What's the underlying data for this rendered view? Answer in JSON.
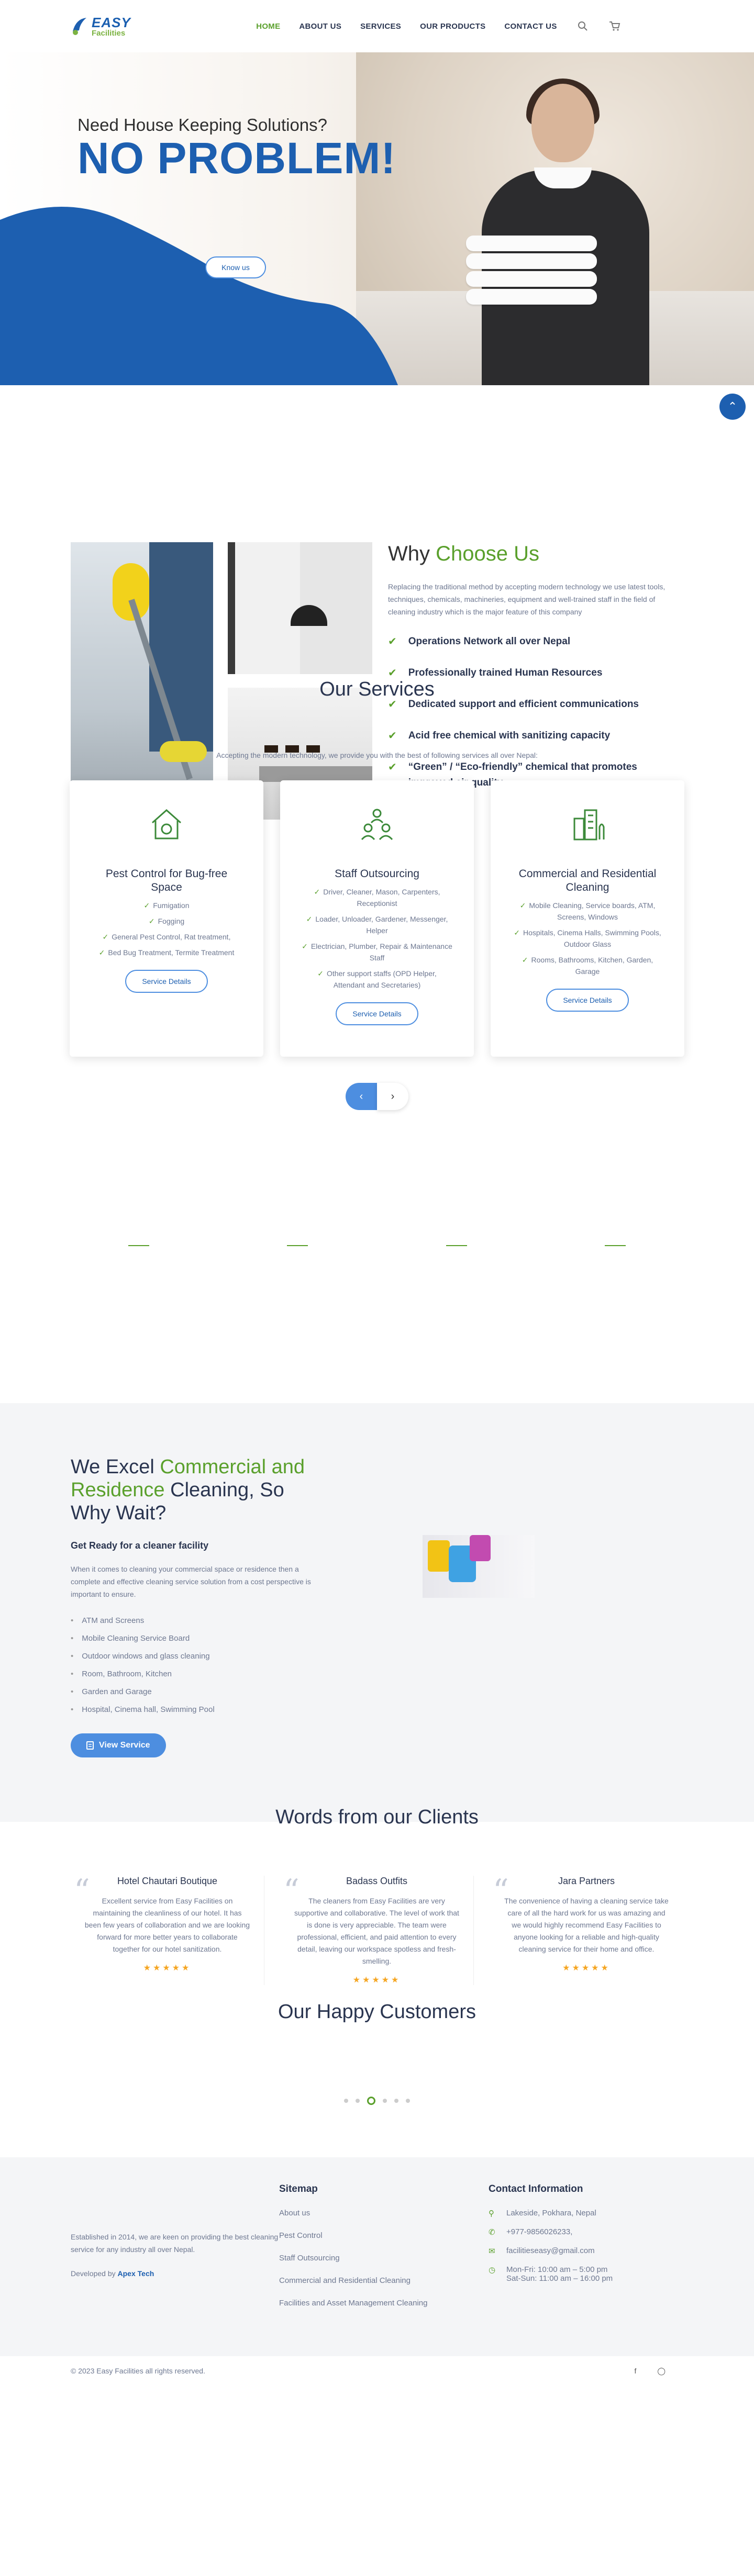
{
  "nav": {
    "logo_top": "EASY",
    "logo_bottom": "Facilities",
    "menu": [
      "HOME",
      "ABOUT US",
      "SERVICES",
      "OUR PRODUCTS",
      "CONTACT US"
    ],
    "search_icon": "search-icon",
    "cart_icon": "cart-icon"
  },
  "hero": {
    "subtitle": "Need House Keeping Solutions?",
    "title": "NO PROBLEM!",
    "button": "Know us",
    "scroll_icon": "chevron-up-icon",
    "wave_color": "#1d5fb0"
  },
  "why": {
    "title_a": "Why ",
    "title_b": "Choose Us",
    "lead": "Replacing the traditional method by accepting modern technology we use latest tools, techniques, chemicals, machineries, equipment and well-trained staff in the field of cleaning industry which is the major feature of this company",
    "items": [
      "Operations Network all over Nepal",
      "Professionally trained Human Resources",
      "Dedicated support and efficient communications",
      "Acid free chemical with sanitizing capacity",
      "“Green” / “Eco-friendly” chemical that promotes improved air quality"
    ]
  },
  "services": {
    "title": "Our Services",
    "lead": "Accepting the modern technology, we provide you with the best of following services all over Nepal:",
    "cards": [
      {
        "title": "Pest Control for Bug-free Space",
        "items": [
          "Fumigation",
          "Fogging",
          "General Pest Control, Rat treatment,",
          "Bed Bug Treatment, Termite Treatment"
        ],
        "button": "Service Details"
      },
      {
        "title": "Staff Outsourcing",
        "items": [
          "Driver, Cleaner, Mason, Carpenters, Receptionist",
          "Loader, Unloader, Gardener, Messenger, Helper",
          "Electrician, Plumber, Repair & Maintenance Staff",
          "Other support staffs (OPD Helper, Attendant and Secretaries)"
        ],
        "button": "Service Details"
      },
      {
        "title": "Commercial and Residential Cleaning",
        "items": [
          "Mobile Cleaning, Service boards, ATM, Screens, Windows",
          "Hospitals, Cinema Halls, Swimming Pools, Outdoor Glass",
          "Rooms, Bathrooms, Kitchen, Garden, Garage"
        ],
        "button": "Service Details"
      }
    ],
    "prev": "‹",
    "next": "›"
  },
  "excel": {
    "title_a": "We Excel ",
    "title_b": "Commercial and Residence",
    "title_c": " Cleaning, So Why Wait?",
    "subtitle": "Get Ready for a cleaner facility",
    "lead": "When it comes to cleaning your commercial space or residence then a complete and effective cleaning service solution from a cost perspective is important to ensure.",
    "items": [
      "ATM and Screens",
      "Mobile Cleaning Service Board",
      "Outdoor windows and glass cleaning",
      "Room, Bathroom, Kitchen",
      "Garden and Garage",
      "Hospital, Cinema hall, Swimming Pool"
    ],
    "button": "View Service"
  },
  "testimonials": {
    "title": "Words from our Clients",
    "items": [
      {
        "name": "Hotel Chautari Boutique",
        "text": "Excellent service from Easy Facilities on maintaining the cleanliness of our hotel. It has been few years of collaboration and we are looking forward for more better years to collaborate together for our hotel sanitization.",
        "stars": "★★★★★"
      },
      {
        "name": "Badass Outfits",
        "text": "The cleaners from Easy Facilities are very supportive and collaborative. The level of work that is done is very appreciable. The team were professional, efficient, and paid attention to every detail, leaving our workspace spotless and fresh-smelling.",
        "stars": "★★★★★"
      },
      {
        "name": "Jara Partners",
        "text": "The convenience of having a cleaning service take care of all the hard work for us was amazing and we would highly recommend Easy Facilities to anyone looking for a reliable and high-quality cleaning service for their home and office.",
        "stars": "★★★★★"
      }
    ]
  },
  "happy": {
    "title": "Our Happy Customers"
  },
  "footer": {
    "about": "Established in 2014, we are keen on providing the best cleaning service for any industry all over Nepal.",
    "dev_label": "Developed by ",
    "dev_name": "Apex Tech",
    "sitemap_title": "Sitemap",
    "sitemap": [
      "About us",
      "Pest Control",
      "Staff Outsourcing",
      "Commercial and Residential Cleaning",
      "Facilities and Asset Management Cleaning"
    ],
    "contact_title": "Contact Information",
    "contact": [
      {
        "icon": "location-icon",
        "text": "Lakeside, Pokhara, Nepal"
      },
      {
        "icon": "phone-icon",
        "text": "+977-9856026233,"
      },
      {
        "icon": "mail-icon",
        "text": "facilitieseasy@gmail.com"
      },
      {
        "icon": "clock-icon",
        "text": "Mon-Fri: 10:00 am – 5:00 pm\nSat-Sun: 11:00 am – 16:00 pm"
      }
    ],
    "copyright": "© 2023 Easy Facilities all rights reserved.",
    "social": [
      "facebook-icon",
      "instagram-icon"
    ]
  }
}
